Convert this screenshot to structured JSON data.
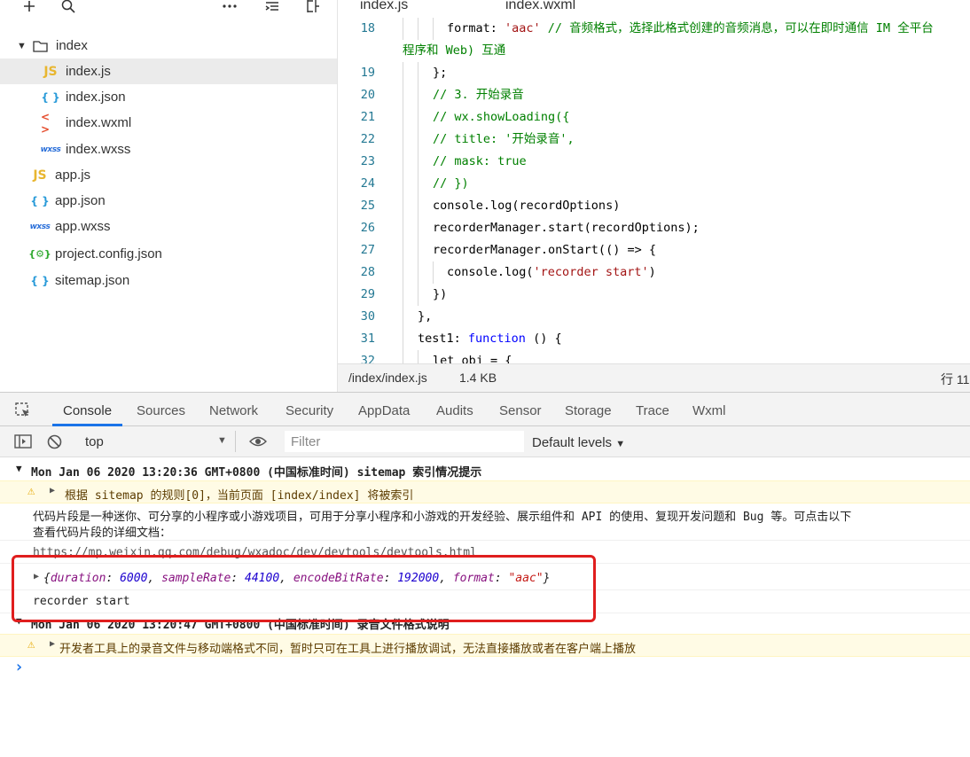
{
  "explorer": {
    "root_label": "index",
    "items": [
      {
        "label": "index.js",
        "icon": "js-file-icon",
        "glyph": "JS"
      },
      {
        "label": "index.json",
        "icon": "json-file-icon",
        "glyph": "{ }"
      },
      {
        "label": "index.wxml",
        "icon": "wxml-file-icon",
        "glyph": "< >"
      },
      {
        "label": "index.wxss",
        "icon": "wxss-file-icon",
        "glyph": "wxss"
      },
      {
        "label": "app.js",
        "icon": "js-file-icon",
        "glyph": "JS"
      },
      {
        "label": "app.json",
        "icon": "json-file-icon",
        "glyph": "{ }"
      },
      {
        "label": "app.wxss",
        "icon": "wxss-file-icon",
        "glyph": "wxss"
      },
      {
        "label": "project.config.json",
        "icon": "config-file-icon",
        "glyph": "{⚙}"
      },
      {
        "label": "sitemap.json",
        "icon": "json-file-icon",
        "glyph": "{ }"
      }
    ]
  },
  "editor": {
    "tabs": [
      "index.js",
      "index.wxml"
    ],
    "lines": [
      {
        "n": "18",
        "parts": [
          [
            "",
            "format: "
          ],
          [
            "str",
            "'aac'"
          ],
          [
            "com",
            " // 音频格式，选择此格式创建的音频消息，可以在即时通信 IM 全平台"
          ]
        ]
      },
      {
        "n": "",
        "parts": [
          [
            "com",
            "程序和 Web) 互通"
          ]
        ]
      },
      {
        "n": "19",
        "parts": [
          [
            "",
            "};"
          ]
        ]
      },
      {
        "n": "20",
        "parts": [
          [
            "com",
            "// 3. 开始录音"
          ]
        ]
      },
      {
        "n": "21",
        "parts": [
          [
            "com",
            "// wx.showLoading({"
          ]
        ]
      },
      {
        "n": "22",
        "parts": [
          [
            "com",
            "// title: '开始录音',"
          ]
        ]
      },
      {
        "n": "23",
        "parts": [
          [
            "com",
            "// mask: true"
          ]
        ]
      },
      {
        "n": "24",
        "parts": [
          [
            "com",
            "// })"
          ]
        ]
      },
      {
        "n": "25",
        "parts": [
          [
            "",
            "console.log(recordOptions)"
          ]
        ]
      },
      {
        "n": "26",
        "parts": [
          [
            "",
            "recorderManager.start(recordOptions);"
          ]
        ]
      },
      {
        "n": "27",
        "parts": [
          [
            "",
            "recorderManager.onStart(() => {"
          ]
        ]
      },
      {
        "n": "28",
        "parts": [
          [
            "",
            "console.log("
          ],
          [
            "str",
            "'recorder start'"
          ],
          [
            "",
            ")"
          ]
        ]
      },
      {
        "n": "29",
        "parts": [
          [
            "",
            "})"
          ]
        ]
      },
      {
        "n": "30",
        "parts": [
          [
            "",
            "},"
          ]
        ]
      },
      {
        "n": "31",
        "parts": [
          [
            "",
            "test1: "
          ],
          [
            "kw",
            "function"
          ],
          [
            "",
            " () {"
          ]
        ]
      },
      {
        "n": "32",
        "parts": [
          [
            "",
            "let obj = {"
          ]
        ]
      }
    ],
    "status": {
      "path": "/index/index.js",
      "size": "1.4 KB",
      "position": "行 11"
    }
  },
  "devtools": {
    "tabs": [
      "Console",
      "Sources",
      "Network",
      "Security",
      "AppData",
      "Audits",
      "Sensor",
      "Storage",
      "Trace",
      "Wxml"
    ],
    "active_tab": "Console",
    "context": "top",
    "filter_placeholder": "Filter",
    "levels_label": "Default levels",
    "console": {
      "group1": "Mon Jan 06 2020 13:20:36 GMT+0800 (中国标准时间) sitemap 索引情况提示",
      "warn1": "根据 sitemap 的规则[0]，当前页面 [index/index] 将被索引",
      "info1_line1": "代码片段是一种迷你、可分享的小程序或小游戏项目，可用于分享小程序和小游戏的开发经验、展示组件和 API 的使用、复现开发问题和 Bug 等。可点击以下",
      "info1_line2": "查看代码片段的详细文档：",
      "url": "https://mp.weixin.qq.com/debug/wxadoc/dev/devtools/devtools.html",
      "object": {
        "duration_key": "duration",
        "duration": "6000",
        "rate_key": "sampleRate",
        "rate": "44100",
        "bitrate_key": "encodeBitRate",
        "bitrate": "192000",
        "format_key": "format",
        "format": "\"aac\""
      },
      "log1": "recorder start",
      "group2": "Mon Jan 06 2020 13:20:47 GMT+0800 (中国标准时间) 录音文件格式说明",
      "warn2": "开发者工具上的录音文件与移动端格式不同，暂时只可在工具上进行播放调试，无法直接播放或者在客户端上播放",
      "prompt": "›"
    }
  },
  "colors": {
    "highlight": "#e01e1e",
    "accent": "#1a73e8",
    "warning_bg": "#fffbe5"
  }
}
